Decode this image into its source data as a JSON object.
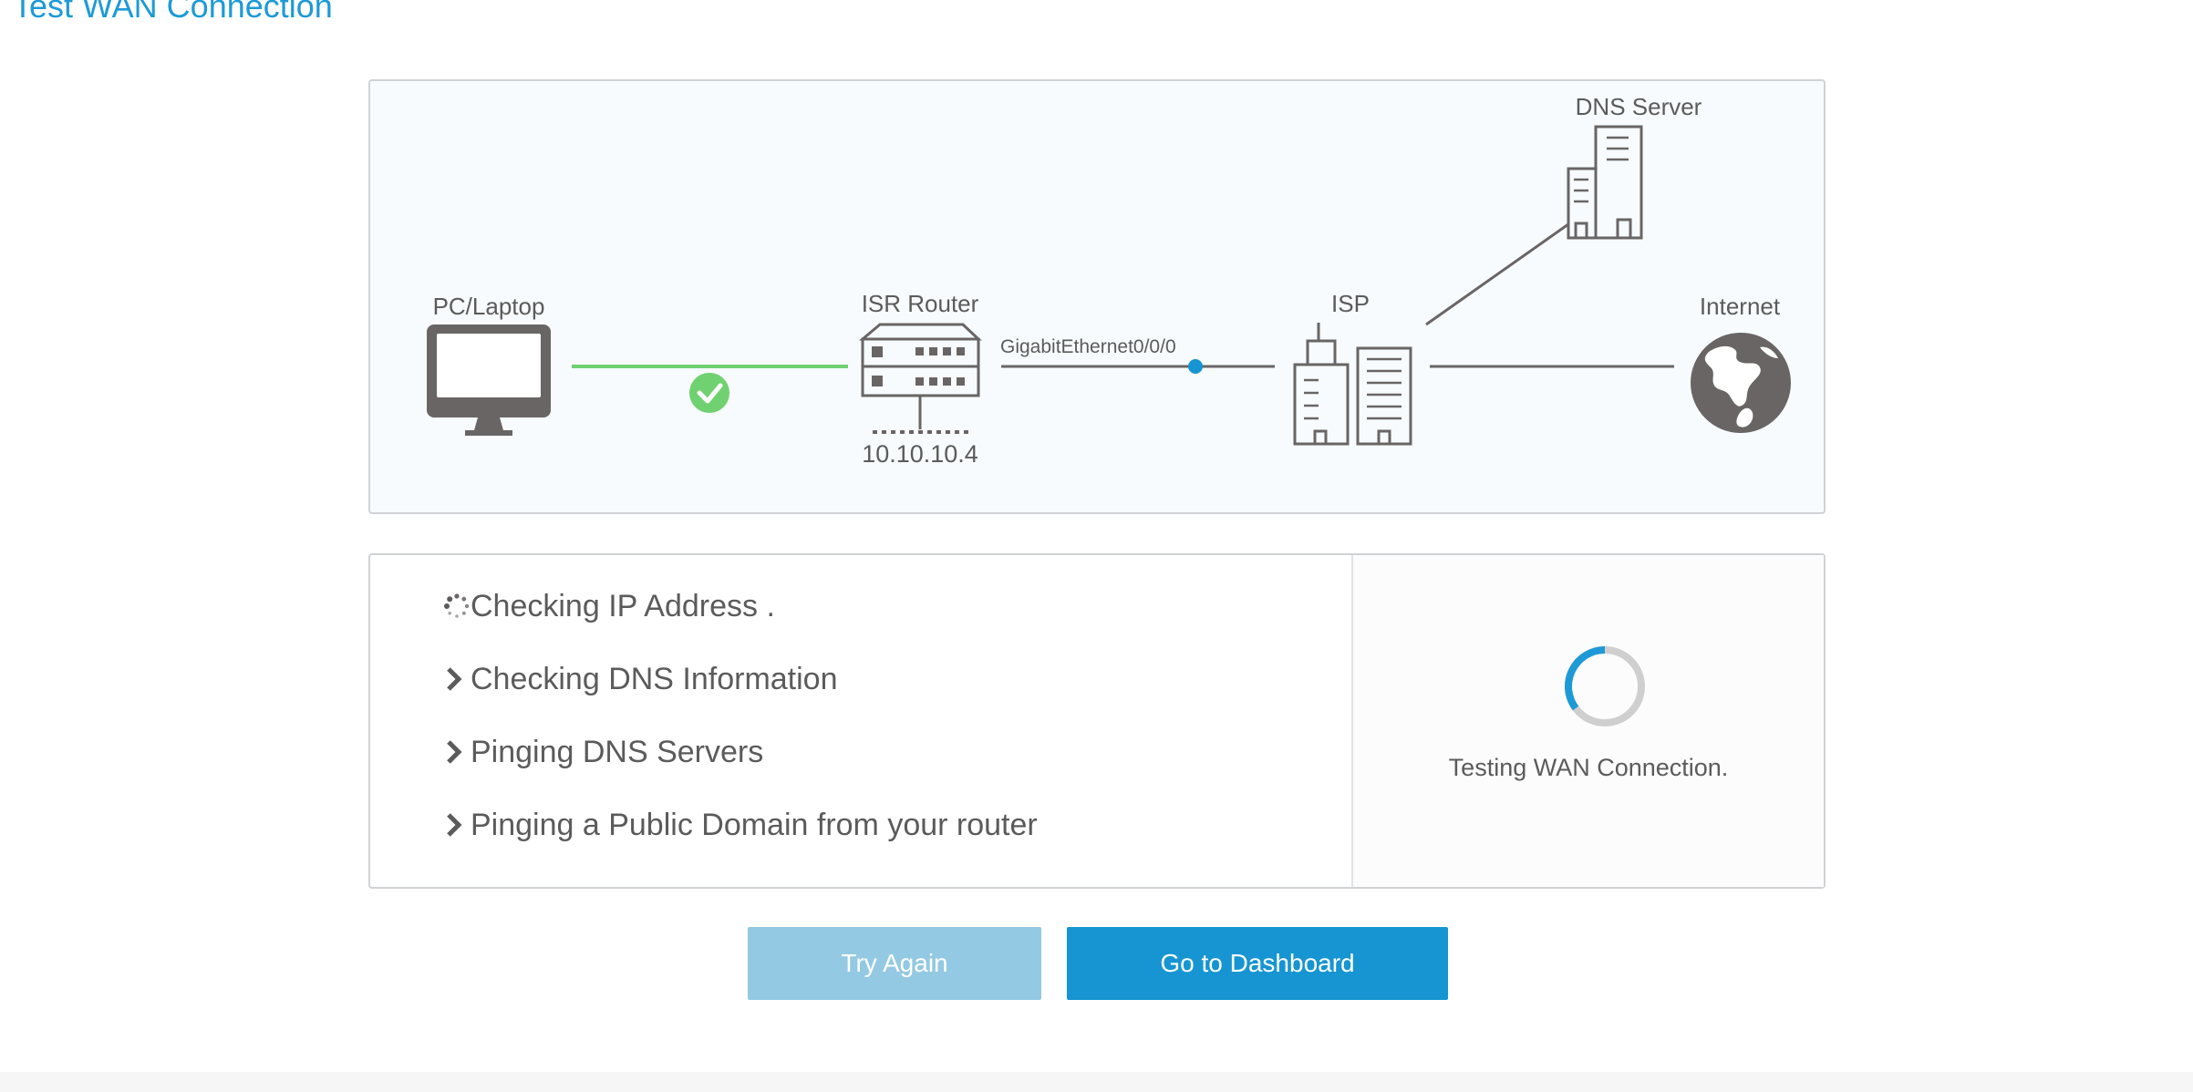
{
  "page": {
    "title": "Test WAN Connection"
  },
  "topology": {
    "nodes": {
      "pc": {
        "label": "PC/Laptop",
        "icon": "monitor-icon"
      },
      "router": {
        "label": "ISR Router",
        "ip": "10.10.10.4",
        "icon": "router-icon"
      },
      "isp": {
        "label": "ISP",
        "icon": "building-icon"
      },
      "dns": {
        "label": "DNS Server",
        "icon": "server-building-icon"
      },
      "internet": {
        "label": "Internet",
        "icon": "globe-icon"
      }
    },
    "link_label": "GigabitEthernet0/0/0",
    "link_pc_router_status": "ok"
  },
  "steps": [
    {
      "label": "Checking IP Address .",
      "state": "in-progress",
      "icon": "loading-dots-icon"
    },
    {
      "label": "Checking DNS Information",
      "state": "pending",
      "icon": "chevron-right-icon"
    },
    {
      "label": "Pinging DNS Servers",
      "state": "pending",
      "icon": "chevron-right-icon"
    },
    {
      "label": "Pinging a Public Domain from your router",
      "state": "pending",
      "icon": "chevron-right-icon"
    }
  ],
  "status": {
    "text": "Testing WAN Connection."
  },
  "buttons": {
    "try_again": "Try Again",
    "dashboard": "Go to Dashboard"
  },
  "colors": {
    "accent": "#1695d2",
    "accent_light": "#93c9e2",
    "success": "#6fd16f",
    "icon_gray": "#6a6565",
    "text": "#5b5b5b"
  }
}
